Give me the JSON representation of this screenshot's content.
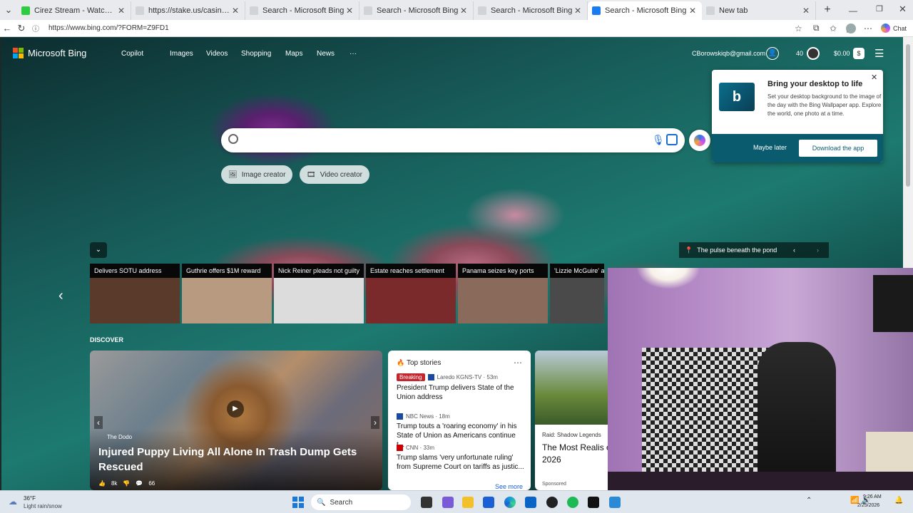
{
  "tabs": [
    {
      "title": "Cirez Stream - Watch Live on",
      "color": "#2ecc40",
      "active": false
    },
    {
      "title": "https://stake.us/casino/games/ev",
      "color": "#d0d4d8",
      "active": false
    },
    {
      "title": "Search - Microsoft Bing",
      "color": "#d0d4d8",
      "active": false
    },
    {
      "title": "Search - Microsoft Bing",
      "color": "#d0d4d8",
      "active": false
    },
    {
      "title": "Search - Microsoft Bing",
      "color": "#d0d4d8",
      "active": false
    },
    {
      "title": "Search - Microsoft Bing",
      "color": "#1a7cf0",
      "active": true
    },
    {
      "title": "New tab",
      "color": "#d0d4d8",
      "active": false
    }
  ],
  "address": {
    "url": "https://www.bing.com/?FORM=Z9FD1",
    "chat_label": "Chat"
  },
  "bing": {
    "logo": "Microsoft Bing",
    "nav": [
      "Copilot",
      "Images",
      "Videos",
      "Shopping",
      "Maps",
      "News",
      "···"
    ],
    "email": "CBorowskiqb@gmail.com",
    "points": "40",
    "balance": "$0.00",
    "buttons": {
      "image_creator": "Image creator",
      "video_creator": "Video creator"
    },
    "location_caption": "The pulse beneath the pond"
  },
  "popup": {
    "title": "Bring your desktop to life",
    "body": "Set your desktop background to the image of the day with the Bing Wallpaper app. Explore the world, one photo at a time.",
    "maybe_later": "Maybe later",
    "download": "Download the app"
  },
  "headlines": [
    {
      "caption": "Delivers SOTU address",
      "color": "#5a3a2a"
    },
    {
      "caption": "Guthrie offers $1M reward",
      "color": "#b89a80"
    },
    {
      "caption": "Nick Reiner pleads not guilty",
      "color": "#dcdcdc"
    },
    {
      "caption": "Estate reaches settlement",
      "color": "#7a2a2a"
    },
    {
      "caption": "Panama seizes key ports",
      "color": "#8a6a5a"
    },
    {
      "caption": "'Lizzie McGuire' act",
      "color": "#4a4a4a"
    }
  ],
  "discover": {
    "label": "DISCOVER",
    "hero": {
      "source": "The Dodo",
      "title": "Injured Puppy Living All Alone In Trash Dump Gets Rescued",
      "likes": "8k",
      "comments": "66"
    }
  },
  "top_stories": {
    "label": "Top stories",
    "items": [
      {
        "badge": "Breaking",
        "source": "Laredo KGNS-TV · 53m",
        "headline": "President Trump delivers State of the Union address"
      },
      {
        "badge": "",
        "source": "NBC News · 18m",
        "headline": "Trump touts a 'roaring economy' in his State of Union as Americans continue t..."
      },
      {
        "badge": "",
        "source": "CNN · 33m",
        "headline": "Trump slams 'very unfortunate ruling' from Supreme Court on tariffs as justic..."
      }
    ],
    "see_more": "See more"
  },
  "promo": {
    "source": "Raid: Shadow Legends",
    "title": "The Most Realis of 2026",
    "sponsored": "Sponsored"
  },
  "taskbar": {
    "weather_temp": "36°F",
    "weather_desc": "Light rain/snow",
    "search_label": "Search",
    "time": "9:26 AM",
    "date": "2/25/2026"
  }
}
